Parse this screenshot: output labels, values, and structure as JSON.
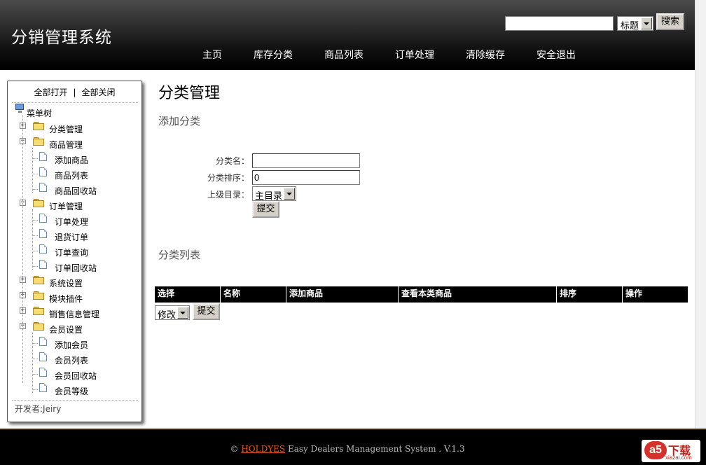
{
  "app": {
    "title": "分销管理系统"
  },
  "search": {
    "value": "",
    "field_selected": "标题",
    "button_label": "搜索"
  },
  "nav": [
    "主页",
    "库存分类",
    "商品列表",
    "订单处理",
    "清除缓存",
    "安全退出"
  ],
  "sidebar": {
    "expand_all": "全部打开",
    "separator": "|",
    "collapse_all": "全部关闭",
    "root": "菜单树",
    "groups": [
      {
        "label": "分类管理",
        "expanded": false,
        "items": []
      },
      {
        "label": "商品管理",
        "expanded": true,
        "items": [
          "添加商品",
          "商品列表",
          "商品回收站"
        ]
      },
      {
        "label": "订单管理",
        "expanded": true,
        "items": [
          "订单处理",
          "退货订单",
          "订单查询",
          "订单回收站"
        ]
      },
      {
        "label": "系统设置",
        "expanded": false,
        "items": []
      },
      {
        "label": "模块插件",
        "expanded": false,
        "items": []
      },
      {
        "label": "销售信息管理",
        "expanded": false,
        "items": []
      },
      {
        "label": "会员设置",
        "expanded": true,
        "items": [
          "添加会员",
          "会员列表",
          "会员回收站",
          "会员等级"
        ]
      }
    ],
    "footer": "开发者:Jeiry"
  },
  "main": {
    "title": "分类管理",
    "add_section": "添加分类",
    "form": {
      "name_label": "分类名：",
      "name_value": "",
      "order_label": "分类排序：",
      "order_value": "0",
      "parent_label": "上级目录：",
      "parent_selected": "主目录",
      "submit_label": "提交"
    },
    "list_section": "分类列表",
    "table": {
      "columns": [
        "选择",
        "名称",
        "添加商品",
        "查看本类商品",
        "排序",
        "操作"
      ],
      "rows": []
    },
    "batch": {
      "action_selected": "修改",
      "submit_label": "提交"
    }
  },
  "footer": {
    "copyright_symbol": "©",
    "brand": "HOLDYES",
    "text": "Easy Dealers Management System . V.1.3"
  },
  "watermark": {
    "logo": "a5",
    "text": "下载",
    "sub": "xiazai.com"
  },
  "colors": {
    "header_bg": "#000000",
    "footer_bg": "#000000",
    "brand_link": "#e2592a",
    "table_head": "#000000"
  }
}
